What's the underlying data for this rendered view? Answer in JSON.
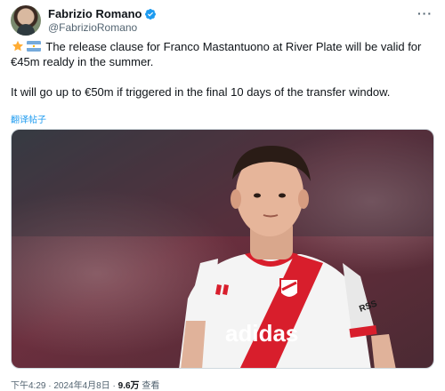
{
  "author": {
    "display_name": "Fabrizio Romano",
    "handle": "@FabrizioRomano",
    "verified_icon": "verified-badge-icon"
  },
  "menu": {
    "more_label": "···"
  },
  "tweet": {
    "paragraph_1": "The release clause for Franco Mastantuono at River Plate will be valid for €45m realdy in the summer.",
    "paragraph_2": "It will go up to €50m if triggered in the final 10 days of the transfer window.",
    "leading_emojis": [
      "star-emoji",
      "argentina-flag-emoji"
    ],
    "translate_label": "翻译帖子"
  },
  "media": {
    "shirt_sponsor": "adidas",
    "sleeve_text": "RSS",
    "colors": {
      "shirt": "#f4f4f4",
      "sash": "#d81e2c",
      "background": "#5a2d3a"
    }
  },
  "meta": {
    "time": "下午4:29",
    "separator": "·",
    "date": "2024年4月8日",
    "views_count": "9.6万",
    "views_label": "查看"
  },
  "colors": {
    "accent": "#1d9bf0",
    "secondary_text": "#536471",
    "primary_text": "#0f1419"
  }
}
